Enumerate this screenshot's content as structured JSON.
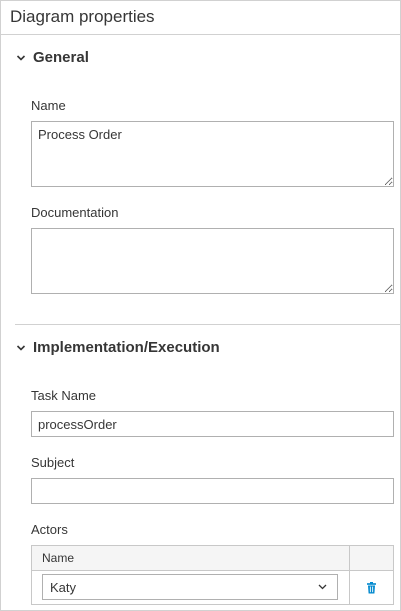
{
  "panel": {
    "title": "Diagram properties"
  },
  "general": {
    "title": "General",
    "name_label": "Name",
    "name_value": "Process Order",
    "documentation_label": "Documentation",
    "documentation_value": ""
  },
  "implementation": {
    "title": "Implementation/Execution",
    "task_name_label": "Task Name",
    "task_name_value": "processOrder",
    "subject_label": "Subject",
    "subject_value": "",
    "actors_label": "Actors",
    "actors_table": {
      "column_name": "Name",
      "rows": [
        {
          "name": "Katy"
        }
      ]
    }
  },
  "colors": {
    "accent": "#0088ce",
    "border": "#d1d1d1",
    "text": "#363636"
  },
  "icons": {
    "section_toggle": "chevron-down-icon",
    "select_toggle": "chevron-down-icon",
    "delete": "trash-icon"
  }
}
